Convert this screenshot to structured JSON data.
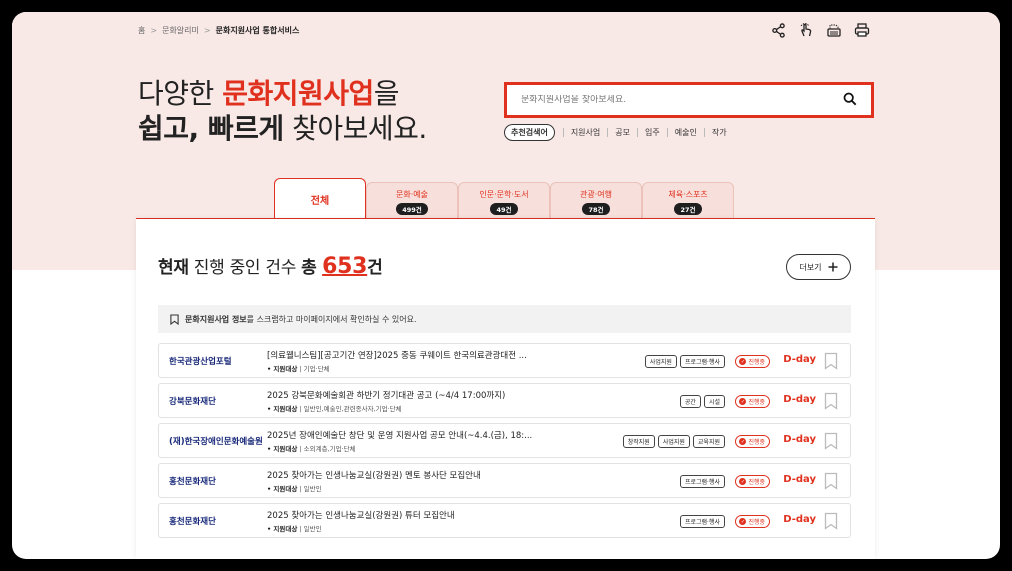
{
  "breadcrumb": [
    "홈",
    "문화알리미",
    "문화지원사업 통합서비스"
  ],
  "tools": [
    "share-icon",
    "touch-icon",
    "scrap-icon",
    "print-icon"
  ],
  "headline": {
    "line1_pre": "다양한 ",
    "line1_red": "문화지원사업",
    "line1_post": "을",
    "line2_bold": "쉽고, 빠르게",
    "line2_post": " 찾아보세요."
  },
  "search": {
    "placeholder": "문화지원사업을 찾아보세요.",
    "value": ""
  },
  "keywords": {
    "tag": "추천검색어",
    "items": [
      "지원사업",
      "공모",
      "입주",
      "예술인",
      "작가"
    ]
  },
  "tabs": [
    {
      "label": "전체",
      "count": ""
    },
    {
      "label": "문화·예술",
      "count": "499건"
    },
    {
      "label": "인문·문학·도서",
      "count": "49건"
    },
    {
      "label": "관광·여행",
      "count": "78건"
    },
    {
      "label": "체육·스포츠",
      "count": "27건"
    }
  ],
  "total": {
    "pre1": "현재",
    "pre2": " 진행 중인 건수 ",
    "pre3": "총 ",
    "num": "653",
    "unit": "건"
  },
  "more_label": "더보기",
  "notice": {
    "bold": "문화지원사업 정보",
    "rest": "를 스크랩하고 마이페이지에서 확인하실 수 있어요."
  },
  "rows": [
    {
      "org": "한국관광산업포털",
      "title": "[의료웰니스팀][공고기간 연장]2025 중동 쿠웨이트 한국의료관광대전 ...",
      "meta_label": "• 지원대상",
      "meta_value": "기업·단체",
      "tags": [
        "사업지원",
        "프로그램·행사"
      ],
      "status": "진행중",
      "dday": "D-day"
    },
    {
      "org": "강북문화재단",
      "title": "2025 강북문화예술회관 하반기 정기대관 공고 (~4/4 17:00까지)",
      "meta_label": "• 지원대상",
      "meta_value": "일반인,예술인,관련종사자,기업·단체",
      "tags": [
        "공간",
        "시설"
      ],
      "status": "진행중",
      "dday": "D-day"
    },
    {
      "org": "(재)한국장애인문화예술원",
      "title": "2025년 장애인예술단 창단 및 운영 지원사업 공모 안내(~4.4.(금), 18:...",
      "meta_label": "• 지원대상",
      "meta_value": "소외계층,기업·단체",
      "tags": [
        "창작지원",
        "사업지원",
        "교육지원"
      ],
      "status": "진행중",
      "dday": "D-day"
    },
    {
      "org": "홍천문화재단",
      "title": "2025 찾아가는 인생나눔교실(강원권) 멘토 봉사단 모집안내",
      "meta_label": "• 지원대상",
      "meta_value": "일반인",
      "tags": [
        "프로그램·행사"
      ],
      "status": "진행중",
      "dday": "D-day"
    },
    {
      "org": "홍천문화재단",
      "title": "2025 찾아가는 인생나눔교실(강원권) 튜터 모집안내",
      "meta_label": "• 지원대상",
      "meta_value": "일반인",
      "tags": [
        "프로그램·행사"
      ],
      "status": "진행중",
      "dday": "D-day"
    }
  ]
}
